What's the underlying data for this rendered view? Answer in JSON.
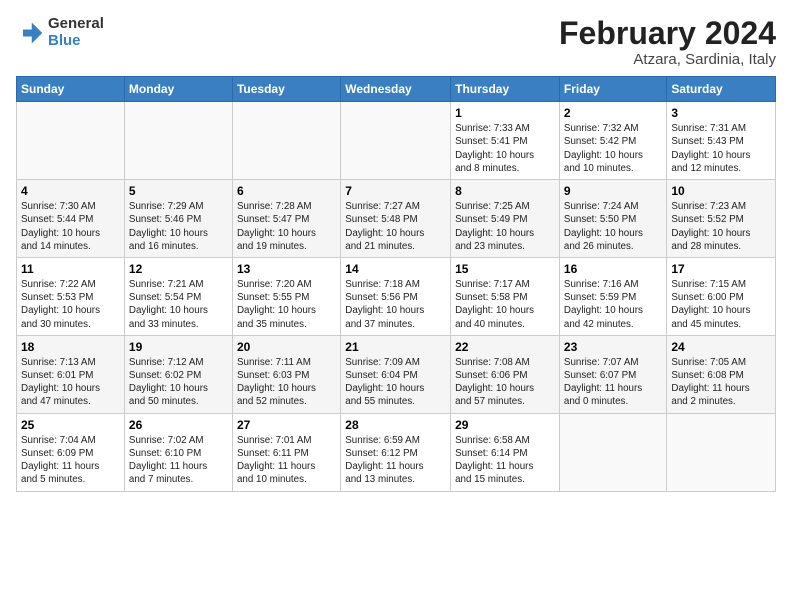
{
  "header": {
    "logo_line1": "General",
    "logo_line2": "Blue",
    "title": "February 2024",
    "subtitle": "Atzara, Sardinia, Italy"
  },
  "weekdays": [
    "Sunday",
    "Monday",
    "Tuesday",
    "Wednesday",
    "Thursday",
    "Friday",
    "Saturday"
  ],
  "weeks": [
    [
      {
        "day": "",
        "info": ""
      },
      {
        "day": "",
        "info": ""
      },
      {
        "day": "",
        "info": ""
      },
      {
        "day": "",
        "info": ""
      },
      {
        "day": "1",
        "info": "Sunrise: 7:33 AM\nSunset: 5:41 PM\nDaylight: 10 hours\nand 8 minutes."
      },
      {
        "day": "2",
        "info": "Sunrise: 7:32 AM\nSunset: 5:42 PM\nDaylight: 10 hours\nand 10 minutes."
      },
      {
        "day": "3",
        "info": "Sunrise: 7:31 AM\nSunset: 5:43 PM\nDaylight: 10 hours\nand 12 minutes."
      }
    ],
    [
      {
        "day": "4",
        "info": "Sunrise: 7:30 AM\nSunset: 5:44 PM\nDaylight: 10 hours\nand 14 minutes."
      },
      {
        "day": "5",
        "info": "Sunrise: 7:29 AM\nSunset: 5:46 PM\nDaylight: 10 hours\nand 16 minutes."
      },
      {
        "day": "6",
        "info": "Sunrise: 7:28 AM\nSunset: 5:47 PM\nDaylight: 10 hours\nand 19 minutes."
      },
      {
        "day": "7",
        "info": "Sunrise: 7:27 AM\nSunset: 5:48 PM\nDaylight: 10 hours\nand 21 minutes."
      },
      {
        "day": "8",
        "info": "Sunrise: 7:25 AM\nSunset: 5:49 PM\nDaylight: 10 hours\nand 23 minutes."
      },
      {
        "day": "9",
        "info": "Sunrise: 7:24 AM\nSunset: 5:50 PM\nDaylight: 10 hours\nand 26 minutes."
      },
      {
        "day": "10",
        "info": "Sunrise: 7:23 AM\nSunset: 5:52 PM\nDaylight: 10 hours\nand 28 minutes."
      }
    ],
    [
      {
        "day": "11",
        "info": "Sunrise: 7:22 AM\nSunset: 5:53 PM\nDaylight: 10 hours\nand 30 minutes."
      },
      {
        "day": "12",
        "info": "Sunrise: 7:21 AM\nSunset: 5:54 PM\nDaylight: 10 hours\nand 33 minutes."
      },
      {
        "day": "13",
        "info": "Sunrise: 7:20 AM\nSunset: 5:55 PM\nDaylight: 10 hours\nand 35 minutes."
      },
      {
        "day": "14",
        "info": "Sunrise: 7:18 AM\nSunset: 5:56 PM\nDaylight: 10 hours\nand 37 minutes."
      },
      {
        "day": "15",
        "info": "Sunrise: 7:17 AM\nSunset: 5:58 PM\nDaylight: 10 hours\nand 40 minutes."
      },
      {
        "day": "16",
        "info": "Sunrise: 7:16 AM\nSunset: 5:59 PM\nDaylight: 10 hours\nand 42 minutes."
      },
      {
        "day": "17",
        "info": "Sunrise: 7:15 AM\nSunset: 6:00 PM\nDaylight: 10 hours\nand 45 minutes."
      }
    ],
    [
      {
        "day": "18",
        "info": "Sunrise: 7:13 AM\nSunset: 6:01 PM\nDaylight: 10 hours\nand 47 minutes."
      },
      {
        "day": "19",
        "info": "Sunrise: 7:12 AM\nSunset: 6:02 PM\nDaylight: 10 hours\nand 50 minutes."
      },
      {
        "day": "20",
        "info": "Sunrise: 7:11 AM\nSunset: 6:03 PM\nDaylight: 10 hours\nand 52 minutes."
      },
      {
        "day": "21",
        "info": "Sunrise: 7:09 AM\nSunset: 6:04 PM\nDaylight: 10 hours\nand 55 minutes."
      },
      {
        "day": "22",
        "info": "Sunrise: 7:08 AM\nSunset: 6:06 PM\nDaylight: 10 hours\nand 57 minutes."
      },
      {
        "day": "23",
        "info": "Sunrise: 7:07 AM\nSunset: 6:07 PM\nDaylight: 11 hours\nand 0 minutes."
      },
      {
        "day": "24",
        "info": "Sunrise: 7:05 AM\nSunset: 6:08 PM\nDaylight: 11 hours\nand 2 minutes."
      }
    ],
    [
      {
        "day": "25",
        "info": "Sunrise: 7:04 AM\nSunset: 6:09 PM\nDaylight: 11 hours\nand 5 minutes."
      },
      {
        "day": "26",
        "info": "Sunrise: 7:02 AM\nSunset: 6:10 PM\nDaylight: 11 hours\nand 7 minutes."
      },
      {
        "day": "27",
        "info": "Sunrise: 7:01 AM\nSunset: 6:11 PM\nDaylight: 11 hours\nand 10 minutes."
      },
      {
        "day": "28",
        "info": "Sunrise: 6:59 AM\nSunset: 6:12 PM\nDaylight: 11 hours\nand 13 minutes."
      },
      {
        "day": "29",
        "info": "Sunrise: 6:58 AM\nSunset: 6:14 PM\nDaylight: 11 hours\nand 15 minutes."
      },
      {
        "day": "",
        "info": ""
      },
      {
        "day": "",
        "info": ""
      }
    ]
  ]
}
